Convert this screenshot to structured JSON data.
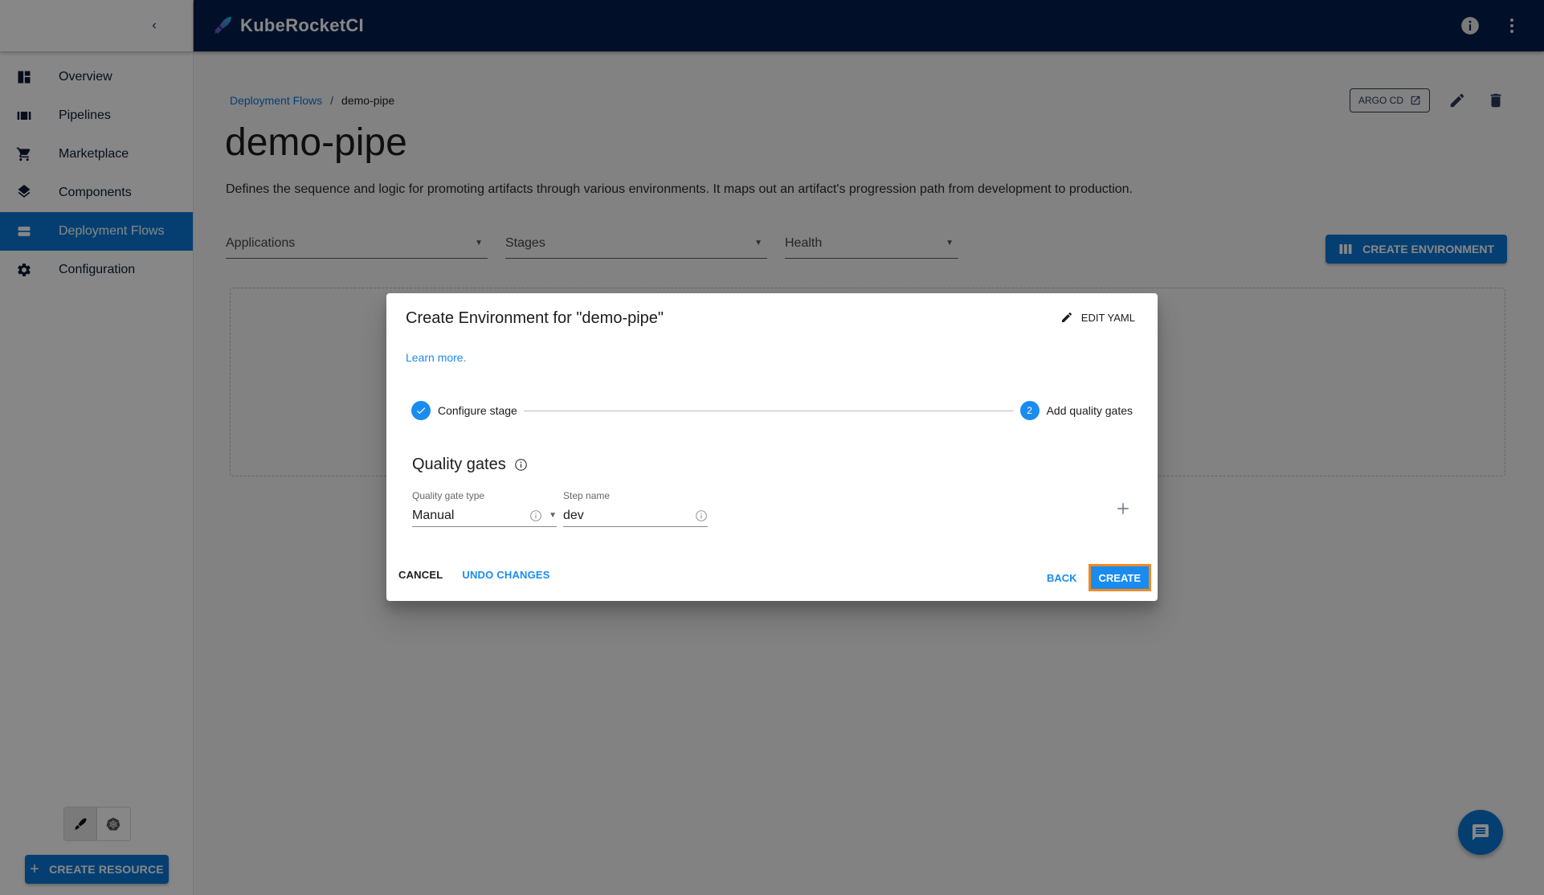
{
  "app": {
    "brand": "KubeRocketCI"
  },
  "sidebar": {
    "items": [
      {
        "label": "Overview",
        "icon": "dashboard-icon",
        "active": false
      },
      {
        "label": "Pipelines",
        "icon": "pipelines-icon",
        "active": false
      },
      {
        "label": "Marketplace",
        "icon": "cart-icon",
        "active": false
      },
      {
        "label": "Components",
        "icon": "layers-icon",
        "active": false
      },
      {
        "label": "Deployment Flows",
        "icon": "flows-icon",
        "active": true
      },
      {
        "label": "Configuration",
        "icon": "gear-icon",
        "active": false
      }
    ],
    "create_resource_label": "CREATE RESOURCE"
  },
  "page": {
    "breadcrumb": {
      "parent": "Deployment Flows",
      "separator": "/",
      "current": "demo-pipe"
    },
    "title": "demo-pipe",
    "description": "Defines the sequence and logic for promoting artifacts through various environments. It maps out an artifact's progression path from development to production.",
    "argo_label": "ARGO CD",
    "filters": {
      "applications": "Applications",
      "stages": "Stages",
      "health": "Health"
    },
    "create_environment_label": "CREATE ENVIRONMENT"
  },
  "dialog": {
    "title": "Create Environment for \"demo-pipe\"",
    "edit_yaml_label": "EDIT YAML",
    "learn_more": "Learn more.",
    "steps": [
      {
        "label": "Configure stage",
        "status": "completed",
        "number": "1"
      },
      {
        "label": "Add quality gates",
        "status": "active",
        "number": "2"
      }
    ],
    "quality_gates_heading": "Quality gates",
    "fields": {
      "gate_type_label": "Quality gate type",
      "gate_type_value": "Manual",
      "step_name_label": "Step name",
      "step_name_value": "dev"
    },
    "buttons": {
      "cancel": "CANCEL",
      "undo": "UNDO CHANGES",
      "back": "BACK",
      "create": "CREATE"
    }
  },
  "colors": {
    "primary": "#0a78d6",
    "dialog_accent": "#1a8cf0",
    "header_bg": "#021f4c",
    "focus_outline": "#f08a24"
  }
}
